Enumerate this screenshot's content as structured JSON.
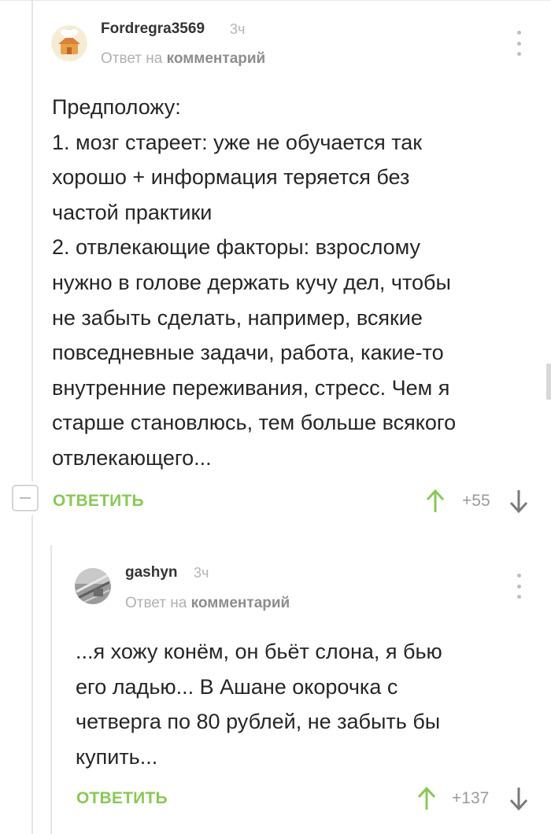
{
  "colors": {
    "accent_green": "#8ac858",
    "vote_up": "#8ac858",
    "vote_down": "#7a7a7a",
    "meta_gray": "#b0b0b0"
  },
  "comments": [
    {
      "author": "Fordregra3569",
      "time": "3ч",
      "reply_prefix": "Ответ на",
      "reply_target": "комментарий",
      "avatar_icon": "chef-house-avatar-icon",
      "body_lines": [
        "Предположу:",
        "1. мозг стареет: уже не обучается так",
        "хорошо + информация теряется без",
        "частой практики",
        "2. отвлекающие факторы: взрослому",
        "нужно в голове держать кучу дел, чтобы",
        "не забыть сделать, например, всякие",
        "повседневные задачи, работа, какие-то",
        "внутренние переживания, стресс. Чем я",
        "старше становлюсь, тем больше всякого",
        "отвлекающего..."
      ],
      "reply_label": "ОТВЕТИТЬ",
      "score": "+55"
    },
    {
      "author": "gashyn",
      "time": "3ч",
      "reply_prefix": "Ответ на",
      "reply_target": "комментарий",
      "avatar_icon": "photo-avatar-icon",
      "body_lines": [
        "...я хожу конём, он бьёт слона, я бью",
        "его ладью... В Ашане окорочка с",
        "четверга по 80 рублей, не забыть бы",
        "купить..."
      ],
      "reply_label": "ОТВЕТИТЬ",
      "score": "+137"
    }
  ]
}
